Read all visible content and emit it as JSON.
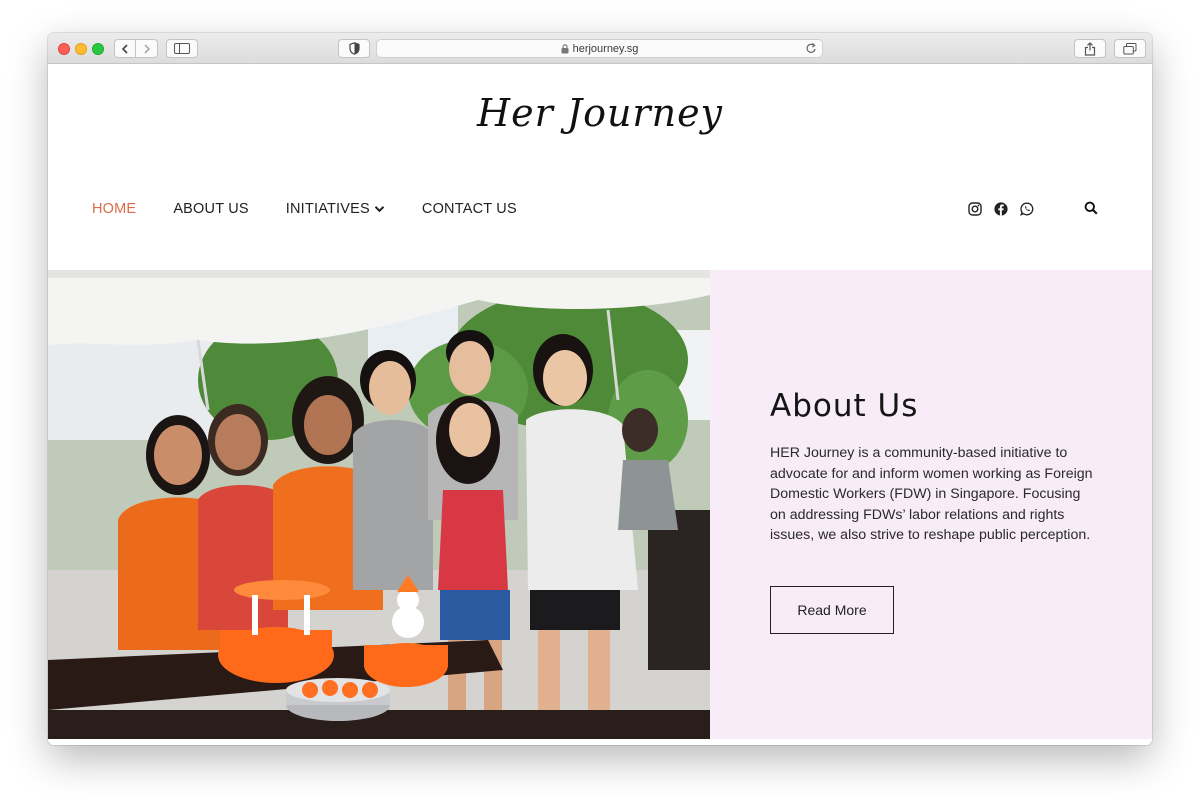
{
  "browser": {
    "url": "herjourney.sg"
  },
  "site": {
    "logo": "Her Journey",
    "nav": [
      {
        "label": "HOME"
      },
      {
        "label": "ABOUT US"
      },
      {
        "label": "INITIATIVES"
      },
      {
        "label": "CONTACT US"
      }
    ],
    "social_icons": [
      "instagram-icon",
      "facebook-icon",
      "whatsapp-icon"
    ],
    "colors": {
      "accent": "#d86c4b",
      "panel": "#f8ecf8"
    }
  },
  "about": {
    "title": "About Us",
    "body": "HER Journey is a community-based initiative to advocate for and inform women working as Foreign Domestic Workers (FDW) in Singapore. Focusing on addressing FDWs’ labor relations and rights issues, we also strive to reshape public perception.",
    "button": "Read More"
  }
}
